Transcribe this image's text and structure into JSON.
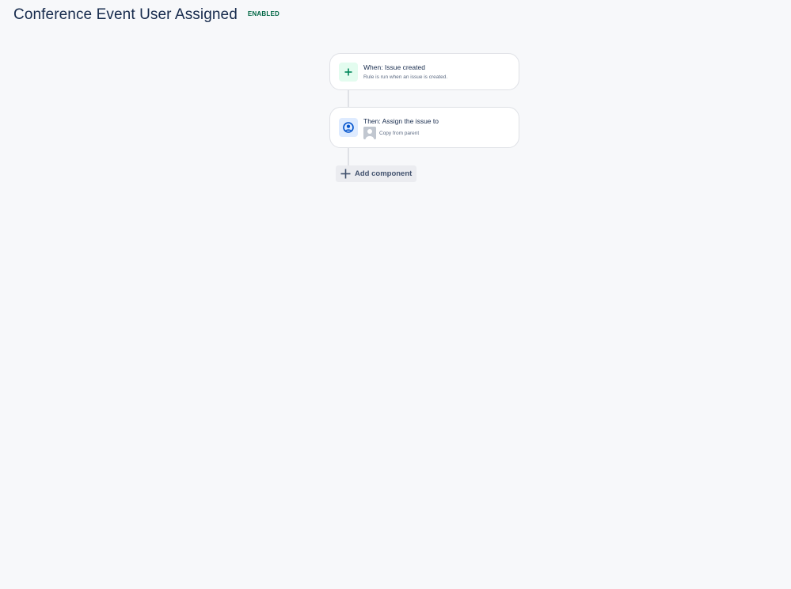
{
  "rule": {
    "title": "Conference Event User Assigned",
    "status": "ENABLED",
    "status_color": "#006644"
  },
  "components": [
    {
      "kind": "trigger",
      "icon": "plus-icon",
      "icon_color": "#00875a",
      "title": "When: Issue created",
      "subtitle": "Rule is run when an issue is created."
    },
    {
      "kind": "action",
      "icon": "user-circle-icon",
      "icon_color": "#0052cc",
      "title": "Then: Assign the issue to",
      "assignee_label": "Copy from parent"
    }
  ],
  "add_component": {
    "label": "Add component",
    "icon": "plus-icon"
  }
}
